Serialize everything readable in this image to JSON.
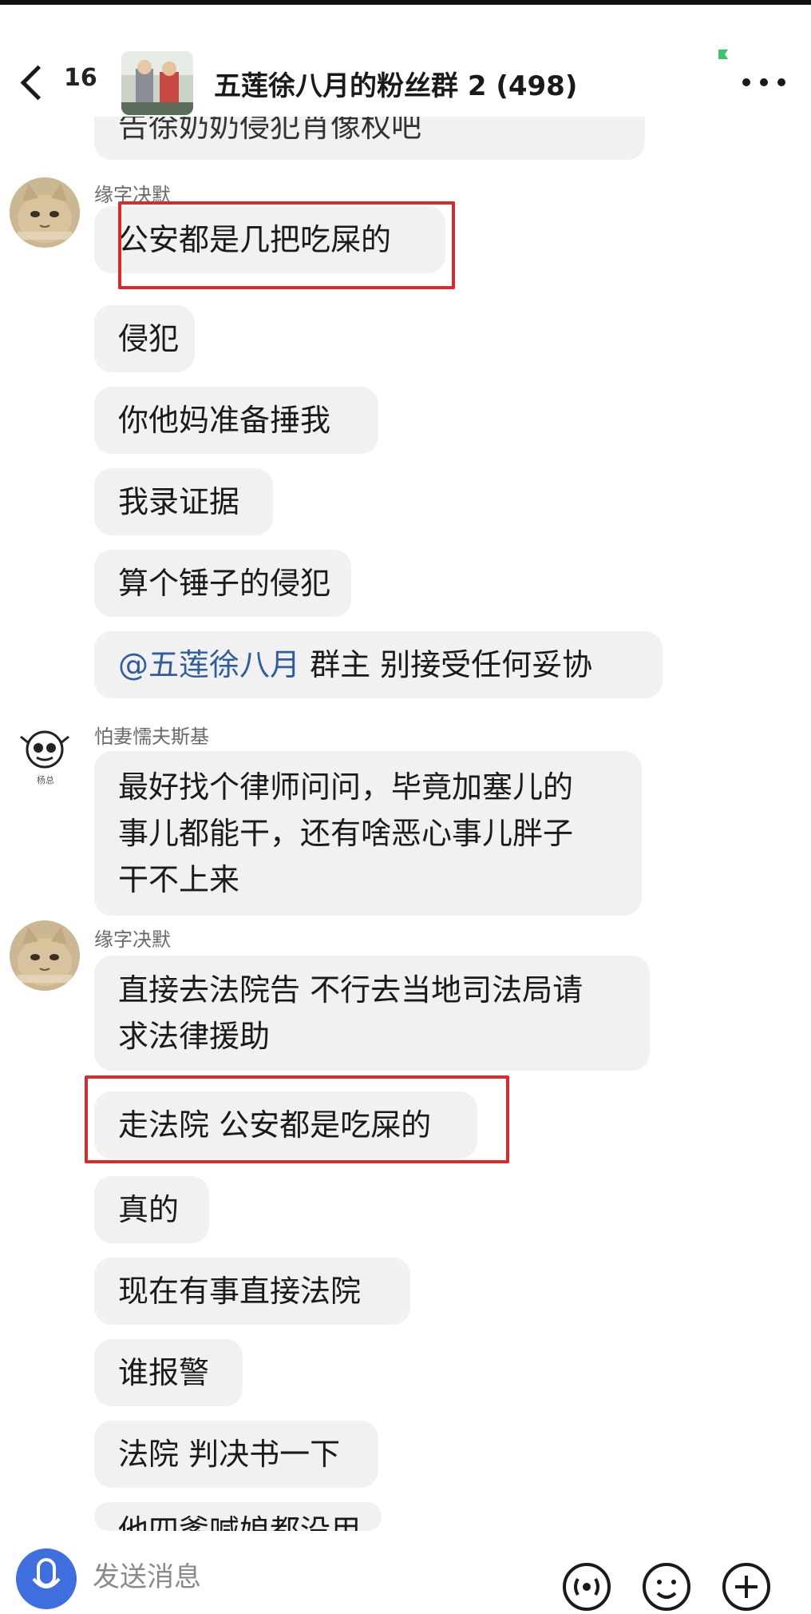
{
  "header": {
    "unread_count": "16",
    "title": "五莲徐八月的粉丝群 2 (498)"
  },
  "messages": {
    "cut_top_text": "告徐奶奶侵犯肖像权吧",
    "group1": {
      "sender": "缘字决默",
      "bubbles": [
        "公安都是几把吃屎的",
        "侵犯",
        "你他妈准备捶我",
        "我录证据",
        "算个锤子的侵犯"
      ],
      "mention": "@五莲徐八月",
      "mention_rest": " 群主 别接受任何妥协"
    },
    "group2": {
      "sender": "怕妻懦夫斯基",
      "avatar_caption": "杨总",
      "lines": [
        "最好找个律师问问，毕竟加塞儿的",
        "事儿都能干，还有啥恶心事儿胖子",
        "干不上来"
      ]
    },
    "group3": {
      "sender": "缘字决默",
      "first_lines": [
        "直接去法院告 不行去当地司法局请",
        "求法律援助"
      ],
      "bubbles": [
        "走法院 公安都是吃屎的",
        "真的",
        "现在有事直接法院",
        "谁报警",
        "法院 判决书一下"
      ],
      "cut_bottom_text": "他四爹喊娘都没用"
    }
  },
  "input_bar": {
    "placeholder": "发送消息"
  },
  "colors": {
    "highlight_box": "#d42d2d",
    "mention": "#2f5d9e",
    "bubble_bg": "#f1f1f1",
    "mic_button": "#3f6fde"
  },
  "icons": [
    "back-arrow-icon",
    "more-icon",
    "microphone-icon",
    "voice-icon",
    "emoji-icon",
    "plus-icon"
  ]
}
